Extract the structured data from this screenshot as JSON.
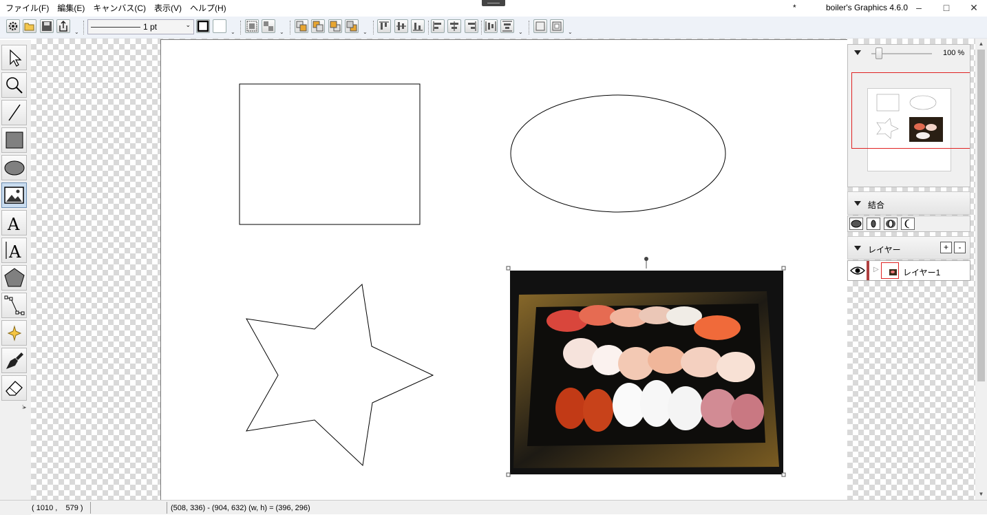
{
  "window": {
    "title": "boiler's Graphics 4.6.0",
    "modified_mark": "*",
    "minimize": "–",
    "maximize": "□",
    "close": "✕"
  },
  "menu": [
    "ファイル(F)",
    "編集(E)",
    "キャンバス(C)",
    "表示(V)",
    "ヘルプ(H)"
  ],
  "toolbar": {
    "line_width": "1 pt",
    "overflow": "⌄"
  },
  "tools": [
    {
      "name": "select-tool",
      "icon": "arrow-icon",
      "active": false
    },
    {
      "name": "zoom-tool",
      "icon": "magnifier-icon",
      "active": false
    },
    {
      "name": "line-tool",
      "icon": "line-icon",
      "active": false
    },
    {
      "name": "rectangle-tool",
      "icon": "rectangle-icon",
      "active": false
    },
    {
      "name": "ellipse-tool",
      "icon": "ellipse-icon",
      "active": false
    },
    {
      "name": "image-tool",
      "icon": "picture-icon",
      "active": true
    },
    {
      "name": "text-tool",
      "icon": "text-icon",
      "active": false
    },
    {
      "name": "vertical-text-tool",
      "icon": "vertical-text-icon",
      "active": false
    },
    {
      "name": "polygon-tool",
      "icon": "pentagon-icon",
      "active": false
    },
    {
      "name": "bezier-tool",
      "icon": "path-icon",
      "active": false
    },
    {
      "name": "star-tool",
      "icon": "sparkle-icon",
      "active": false
    },
    {
      "name": "brush-tool",
      "icon": "brush-icon",
      "active": false
    },
    {
      "name": "eraser-tool",
      "icon": "eraser-icon",
      "active": false
    }
  ],
  "navigator": {
    "zoom": "100 %"
  },
  "combine_panel": {
    "title": "結合"
  },
  "layer_panel": {
    "title": "レイヤー",
    "add": "+",
    "remove": "-",
    "layers": [
      {
        "name": "レイヤー1",
        "visible": true
      }
    ]
  },
  "status": {
    "cursor": "( 1010 ,    579 )",
    "selection": "(508, 336) - (904, 632) (w, h) = (396, 296)"
  },
  "colors": {
    "accent_selection": "#e02020",
    "layer_marker": "#b04040",
    "active_tool": "#c9dcef"
  }
}
